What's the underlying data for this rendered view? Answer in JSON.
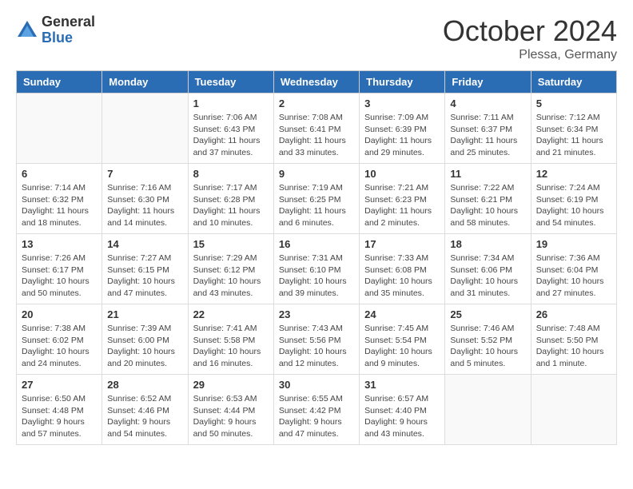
{
  "logo": {
    "general": "General",
    "blue": "Blue"
  },
  "header": {
    "month": "October 2024",
    "location": "Plessa, Germany"
  },
  "weekdays": [
    "Sunday",
    "Monday",
    "Tuesday",
    "Wednesday",
    "Thursday",
    "Friday",
    "Saturday"
  ],
  "weeks": [
    [
      {
        "day": "",
        "sunrise": "",
        "sunset": "",
        "daylight": ""
      },
      {
        "day": "",
        "sunrise": "",
        "sunset": "",
        "daylight": ""
      },
      {
        "day": "1",
        "sunrise": "Sunrise: 7:06 AM",
        "sunset": "Sunset: 6:43 PM",
        "daylight": "Daylight: 11 hours and 37 minutes."
      },
      {
        "day": "2",
        "sunrise": "Sunrise: 7:08 AM",
        "sunset": "Sunset: 6:41 PM",
        "daylight": "Daylight: 11 hours and 33 minutes."
      },
      {
        "day": "3",
        "sunrise": "Sunrise: 7:09 AM",
        "sunset": "Sunset: 6:39 PM",
        "daylight": "Daylight: 11 hours and 29 minutes."
      },
      {
        "day": "4",
        "sunrise": "Sunrise: 7:11 AM",
        "sunset": "Sunset: 6:37 PM",
        "daylight": "Daylight: 11 hours and 25 minutes."
      },
      {
        "day": "5",
        "sunrise": "Sunrise: 7:12 AM",
        "sunset": "Sunset: 6:34 PM",
        "daylight": "Daylight: 11 hours and 21 minutes."
      }
    ],
    [
      {
        "day": "6",
        "sunrise": "Sunrise: 7:14 AM",
        "sunset": "Sunset: 6:32 PM",
        "daylight": "Daylight: 11 hours and 18 minutes."
      },
      {
        "day": "7",
        "sunrise": "Sunrise: 7:16 AM",
        "sunset": "Sunset: 6:30 PM",
        "daylight": "Daylight: 11 hours and 14 minutes."
      },
      {
        "day": "8",
        "sunrise": "Sunrise: 7:17 AM",
        "sunset": "Sunset: 6:28 PM",
        "daylight": "Daylight: 11 hours and 10 minutes."
      },
      {
        "day": "9",
        "sunrise": "Sunrise: 7:19 AM",
        "sunset": "Sunset: 6:25 PM",
        "daylight": "Daylight: 11 hours and 6 minutes."
      },
      {
        "day": "10",
        "sunrise": "Sunrise: 7:21 AM",
        "sunset": "Sunset: 6:23 PM",
        "daylight": "Daylight: 11 hours and 2 minutes."
      },
      {
        "day": "11",
        "sunrise": "Sunrise: 7:22 AM",
        "sunset": "Sunset: 6:21 PM",
        "daylight": "Daylight: 10 hours and 58 minutes."
      },
      {
        "day": "12",
        "sunrise": "Sunrise: 7:24 AM",
        "sunset": "Sunset: 6:19 PM",
        "daylight": "Daylight: 10 hours and 54 minutes."
      }
    ],
    [
      {
        "day": "13",
        "sunrise": "Sunrise: 7:26 AM",
        "sunset": "Sunset: 6:17 PM",
        "daylight": "Daylight: 10 hours and 50 minutes."
      },
      {
        "day": "14",
        "sunrise": "Sunrise: 7:27 AM",
        "sunset": "Sunset: 6:15 PM",
        "daylight": "Daylight: 10 hours and 47 minutes."
      },
      {
        "day": "15",
        "sunrise": "Sunrise: 7:29 AM",
        "sunset": "Sunset: 6:12 PM",
        "daylight": "Daylight: 10 hours and 43 minutes."
      },
      {
        "day": "16",
        "sunrise": "Sunrise: 7:31 AM",
        "sunset": "Sunset: 6:10 PM",
        "daylight": "Daylight: 10 hours and 39 minutes."
      },
      {
        "day": "17",
        "sunrise": "Sunrise: 7:33 AM",
        "sunset": "Sunset: 6:08 PM",
        "daylight": "Daylight: 10 hours and 35 minutes."
      },
      {
        "day": "18",
        "sunrise": "Sunrise: 7:34 AM",
        "sunset": "Sunset: 6:06 PM",
        "daylight": "Daylight: 10 hours and 31 minutes."
      },
      {
        "day": "19",
        "sunrise": "Sunrise: 7:36 AM",
        "sunset": "Sunset: 6:04 PM",
        "daylight": "Daylight: 10 hours and 27 minutes."
      }
    ],
    [
      {
        "day": "20",
        "sunrise": "Sunrise: 7:38 AM",
        "sunset": "Sunset: 6:02 PM",
        "daylight": "Daylight: 10 hours and 24 minutes."
      },
      {
        "day": "21",
        "sunrise": "Sunrise: 7:39 AM",
        "sunset": "Sunset: 6:00 PM",
        "daylight": "Daylight: 10 hours and 20 minutes."
      },
      {
        "day": "22",
        "sunrise": "Sunrise: 7:41 AM",
        "sunset": "Sunset: 5:58 PM",
        "daylight": "Daylight: 10 hours and 16 minutes."
      },
      {
        "day": "23",
        "sunrise": "Sunrise: 7:43 AM",
        "sunset": "Sunset: 5:56 PM",
        "daylight": "Daylight: 10 hours and 12 minutes."
      },
      {
        "day": "24",
        "sunrise": "Sunrise: 7:45 AM",
        "sunset": "Sunset: 5:54 PM",
        "daylight": "Daylight: 10 hours and 9 minutes."
      },
      {
        "day": "25",
        "sunrise": "Sunrise: 7:46 AM",
        "sunset": "Sunset: 5:52 PM",
        "daylight": "Daylight: 10 hours and 5 minutes."
      },
      {
        "day": "26",
        "sunrise": "Sunrise: 7:48 AM",
        "sunset": "Sunset: 5:50 PM",
        "daylight": "Daylight: 10 hours and 1 minute."
      }
    ],
    [
      {
        "day": "27",
        "sunrise": "Sunrise: 6:50 AM",
        "sunset": "Sunset: 4:48 PM",
        "daylight": "Daylight: 9 hours and 57 minutes."
      },
      {
        "day": "28",
        "sunrise": "Sunrise: 6:52 AM",
        "sunset": "Sunset: 4:46 PM",
        "daylight": "Daylight: 9 hours and 54 minutes."
      },
      {
        "day": "29",
        "sunrise": "Sunrise: 6:53 AM",
        "sunset": "Sunset: 4:44 PM",
        "daylight": "Daylight: 9 hours and 50 minutes."
      },
      {
        "day": "30",
        "sunrise": "Sunrise: 6:55 AM",
        "sunset": "Sunset: 4:42 PM",
        "daylight": "Daylight: 9 hours and 47 minutes."
      },
      {
        "day": "31",
        "sunrise": "Sunrise: 6:57 AM",
        "sunset": "Sunset: 4:40 PM",
        "daylight": "Daylight: 9 hours and 43 minutes."
      },
      {
        "day": "",
        "sunrise": "",
        "sunset": "",
        "daylight": ""
      },
      {
        "day": "",
        "sunrise": "",
        "sunset": "",
        "daylight": ""
      }
    ]
  ]
}
